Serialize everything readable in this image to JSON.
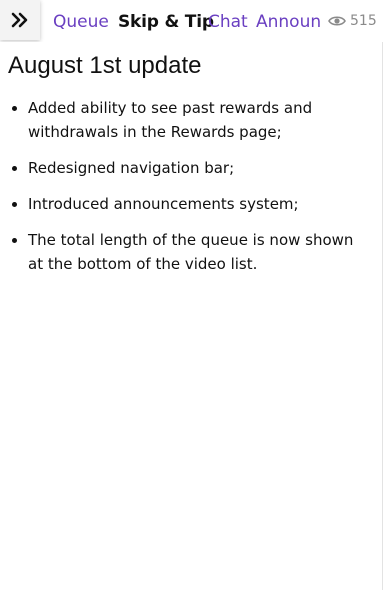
{
  "nav": {
    "toggle_icon": "double-chevron-right-icon",
    "tabs": [
      {
        "label": "Queue",
        "active": false
      },
      {
        "label": "Skip & Tip",
        "active": true
      },
      {
        "label": "Chat",
        "active": false
      },
      {
        "label": "Announ",
        "active": false
      }
    ],
    "viewer_icon": "eye-icon",
    "viewer_count": "515",
    "accent_color": "#6a3fc1"
  },
  "announcement": {
    "title": "August 1st update",
    "items": [
      "Added ability to see past rewards and withdrawals in the Rewards page;",
      "Redesigned navigation bar;",
      "Introduced announcements system;",
      "The total length of the queue is now shown at the bottom of the video list."
    ]
  }
}
